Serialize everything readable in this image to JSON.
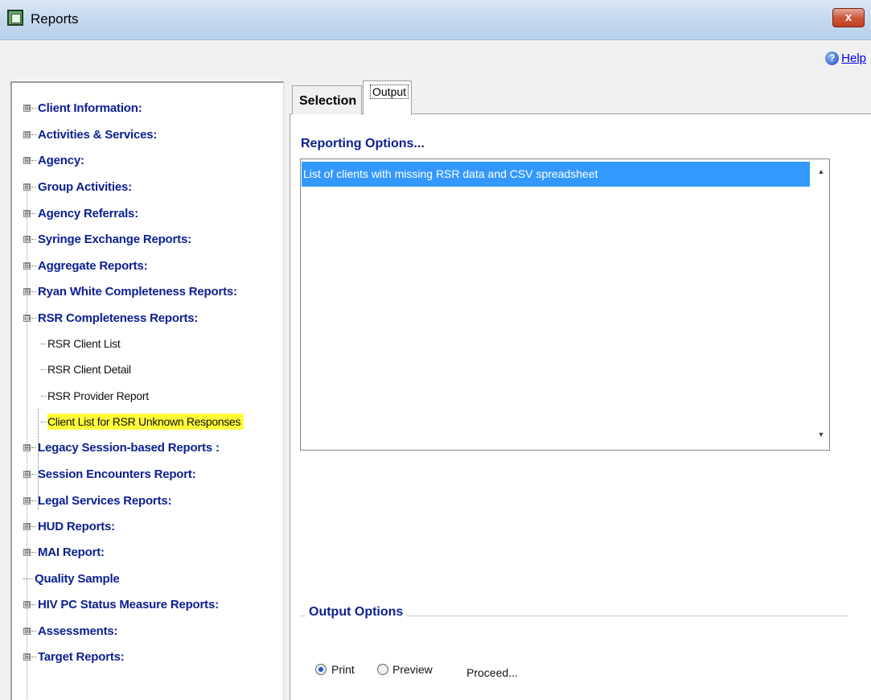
{
  "window": {
    "title": "Reports",
    "close_label": "x",
    "help_label": "Help"
  },
  "tree": {
    "items": [
      {
        "label": "Client Information:",
        "expander": "⊞"
      },
      {
        "label": "Activities & Services:",
        "expander": "⊞"
      },
      {
        "label": "Agency:",
        "expander": "⊞"
      },
      {
        "label": "Group Activities:",
        "expander": "⊞"
      },
      {
        "label": "Agency Referrals:",
        "expander": "⊞"
      },
      {
        "label": "Syringe Exchange Reports:",
        "expander": "⊞"
      },
      {
        "label": "Aggregate Reports:",
        "expander": "⊞"
      },
      {
        "label": "Ryan White Completeness Reports:",
        "expander": "⊞"
      },
      {
        "label": "RSR Completeness Reports:",
        "expander": "⊟"
      },
      {
        "label": "Legacy Session-based Reports :",
        "expander": "⊞"
      },
      {
        "label": "Session Encounters Report:",
        "expander": "⊞"
      },
      {
        "label": "Legal Services Reports:",
        "expander": "⊞"
      },
      {
        "label": "HUD Reports:",
        "expander": "⊞"
      },
      {
        "label": "MAI Report:",
        "expander": "⊞"
      },
      {
        "label": "Quality Sample",
        "expander": ""
      },
      {
        "label": "HIV PC Status Measure Reports:",
        "expander": "⊞"
      },
      {
        "label": "Assessments:",
        "expander": "⊞"
      },
      {
        "label": "Target Reports:",
        "expander": "⊞"
      }
    ],
    "rsr_children": [
      "RSR Client List",
      "RSR Client Detail",
      "RSR Provider Report",
      "Client List for RSR Unknown Responses"
    ],
    "highlight_color": "#fffb3a"
  },
  "tabs": {
    "selection": "Selection",
    "output": "Output"
  },
  "reporting": {
    "title": "Reporting Options...",
    "options": [
      "List of clients with missing RSR data and CSV spreadsheet"
    ],
    "selected_color": "#3399ff"
  },
  "output_options": {
    "title": "Output Options",
    "print": "Print",
    "preview": "Preview",
    "selected": "Print",
    "proceed": "Proceed..."
  }
}
